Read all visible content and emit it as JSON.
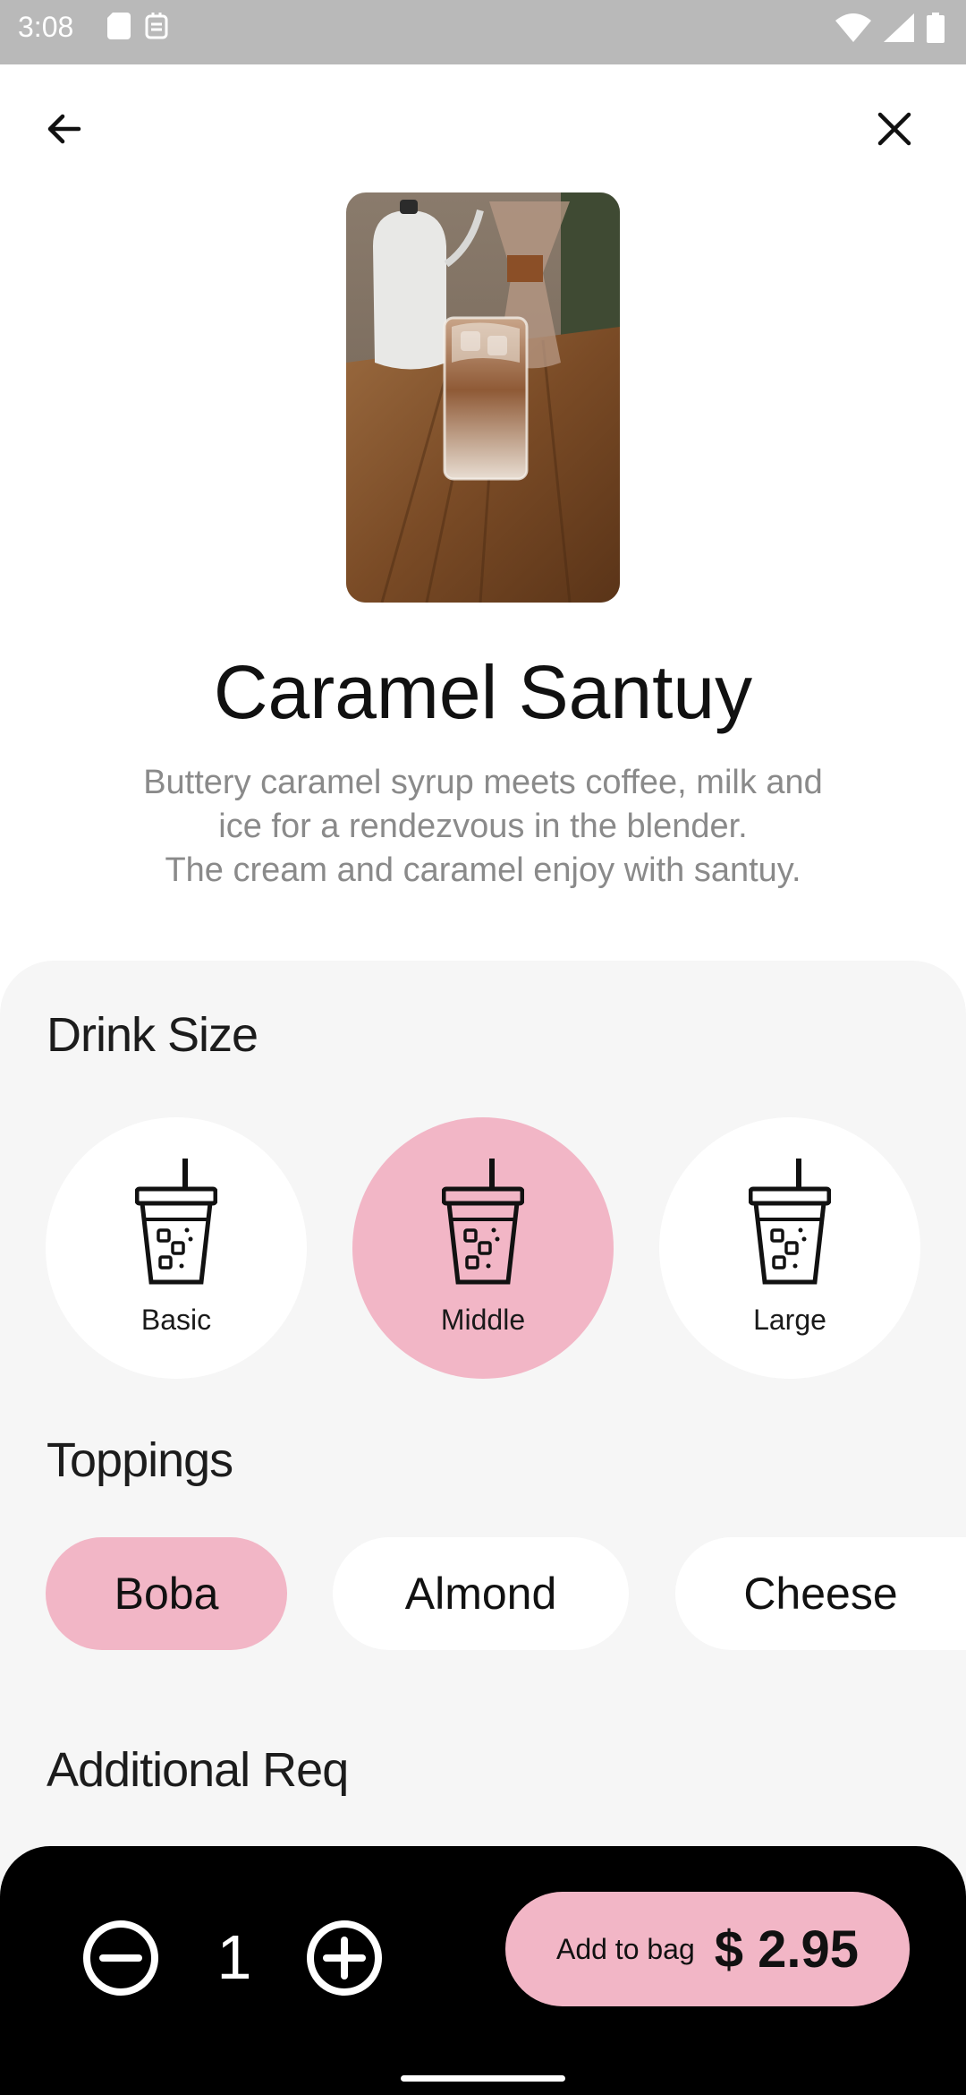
{
  "status_bar": {
    "time": "3:08",
    "left_icons": [
      "sd-card-icon",
      "storage-icon"
    ],
    "right_icons": [
      "wifi-icon",
      "signal-icon",
      "battery-icon"
    ]
  },
  "nav": {
    "back_icon": "arrow-left-icon",
    "close_icon": "close-icon"
  },
  "product": {
    "image_alt": "Iced caramel coffee in a glass on a wooden table",
    "title": "Caramel Santuy",
    "description": [
      "Buttery caramel syrup meets coffee, milk and",
      "ice for a rendezvous in the blender.",
      "The cream and caramel enjoy with santuy."
    ]
  },
  "drink_size": {
    "title": "Drink Size",
    "options": [
      {
        "label": "Basic",
        "selected": false
      },
      {
        "label": "Middle",
        "selected": true
      },
      {
        "label": "Large",
        "selected": false
      }
    ]
  },
  "toppings": {
    "title": "Toppings",
    "options": [
      {
        "label": "Boba",
        "selected": true
      },
      {
        "label": "Almond",
        "selected": false
      },
      {
        "label": "Cheese",
        "selected": false
      }
    ]
  },
  "additional": {
    "title": "Additional Req"
  },
  "cart": {
    "quantity": "1",
    "add_label": "Add to bag",
    "price": "$ 2.95"
  },
  "colors": {
    "accent_pink": "#f2b6c6",
    "panel_bg": "#f6f6f6",
    "bottom_bar": "#000000",
    "status_bar": "#b9b9b9"
  }
}
